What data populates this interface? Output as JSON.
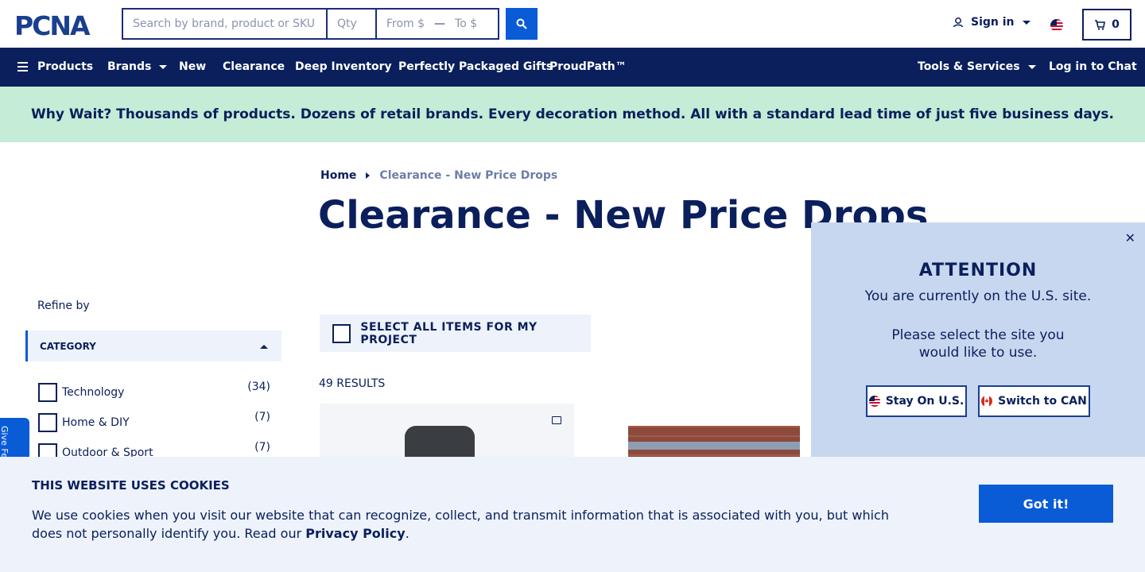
{
  "header": {
    "logo_text": "PCNA",
    "search_placeholder": "Search by brand, product or SKU",
    "qty_placeholder": "Qty",
    "price_from_placeholder": "From $",
    "price_to_placeholder": "To $",
    "sign_in_label": "Sign in",
    "cart_count": "0"
  },
  "nav": {
    "items": [
      {
        "label": "Products"
      },
      {
        "label": "Brands"
      },
      {
        "label": "New"
      },
      {
        "label": "Clearance"
      },
      {
        "label": "Deep Inventory"
      },
      {
        "label": "Perfectly Packaged Gifts"
      },
      {
        "label": "ProudPath™"
      },
      {
        "label": "Tools & Services"
      },
      {
        "label": "Log in to Chat"
      }
    ]
  },
  "banner": {
    "text": "Why Wait? Thousands of products. Dozens of retail brands. Every decoration method. All with a standard lead time of just five business days."
  },
  "breadcrumb": {
    "home": "Home",
    "current": "Clearance - New Price Drops"
  },
  "page": {
    "title": "Clearance - New Price Drops",
    "refine_by": "Refine by",
    "category_header": "CATEGORY",
    "select_all_label": "SELECT ALL ITEMS FOR MY PROJECT",
    "results_label": "49 RESULTS"
  },
  "categories": [
    {
      "label": "Technology",
      "count": "(34)"
    },
    {
      "label": "Home & DIY",
      "count": "(7)"
    },
    {
      "label": "Outdoor & Sport",
      "count": "(7)"
    }
  ],
  "feedback": {
    "label": "Give Feedback"
  },
  "attention": {
    "title": "ATTENTION",
    "line1": "You are currently on the U.S. site.",
    "line2": "Please select the site you",
    "line3": "would like to use.",
    "stay_label": "Stay On U.S.",
    "switch_label": "Switch to CAN"
  },
  "cookie": {
    "title": "THIS WEBSITE USES COOKIES",
    "text_before": "We use cookies when you visit our website that can recognize, collect, and transmit information that is associated with you, but which does not personally identify you. Read our ",
    "policy_link": "Privacy Policy",
    "text_after": ".",
    "button_label": "Got it!"
  },
  "colors": {
    "navy": "#0a1f5c",
    "accent_blue": "#0a5bd6",
    "banner_green": "#c4ecd6",
    "popup_blue": "#c7d7ef"
  }
}
